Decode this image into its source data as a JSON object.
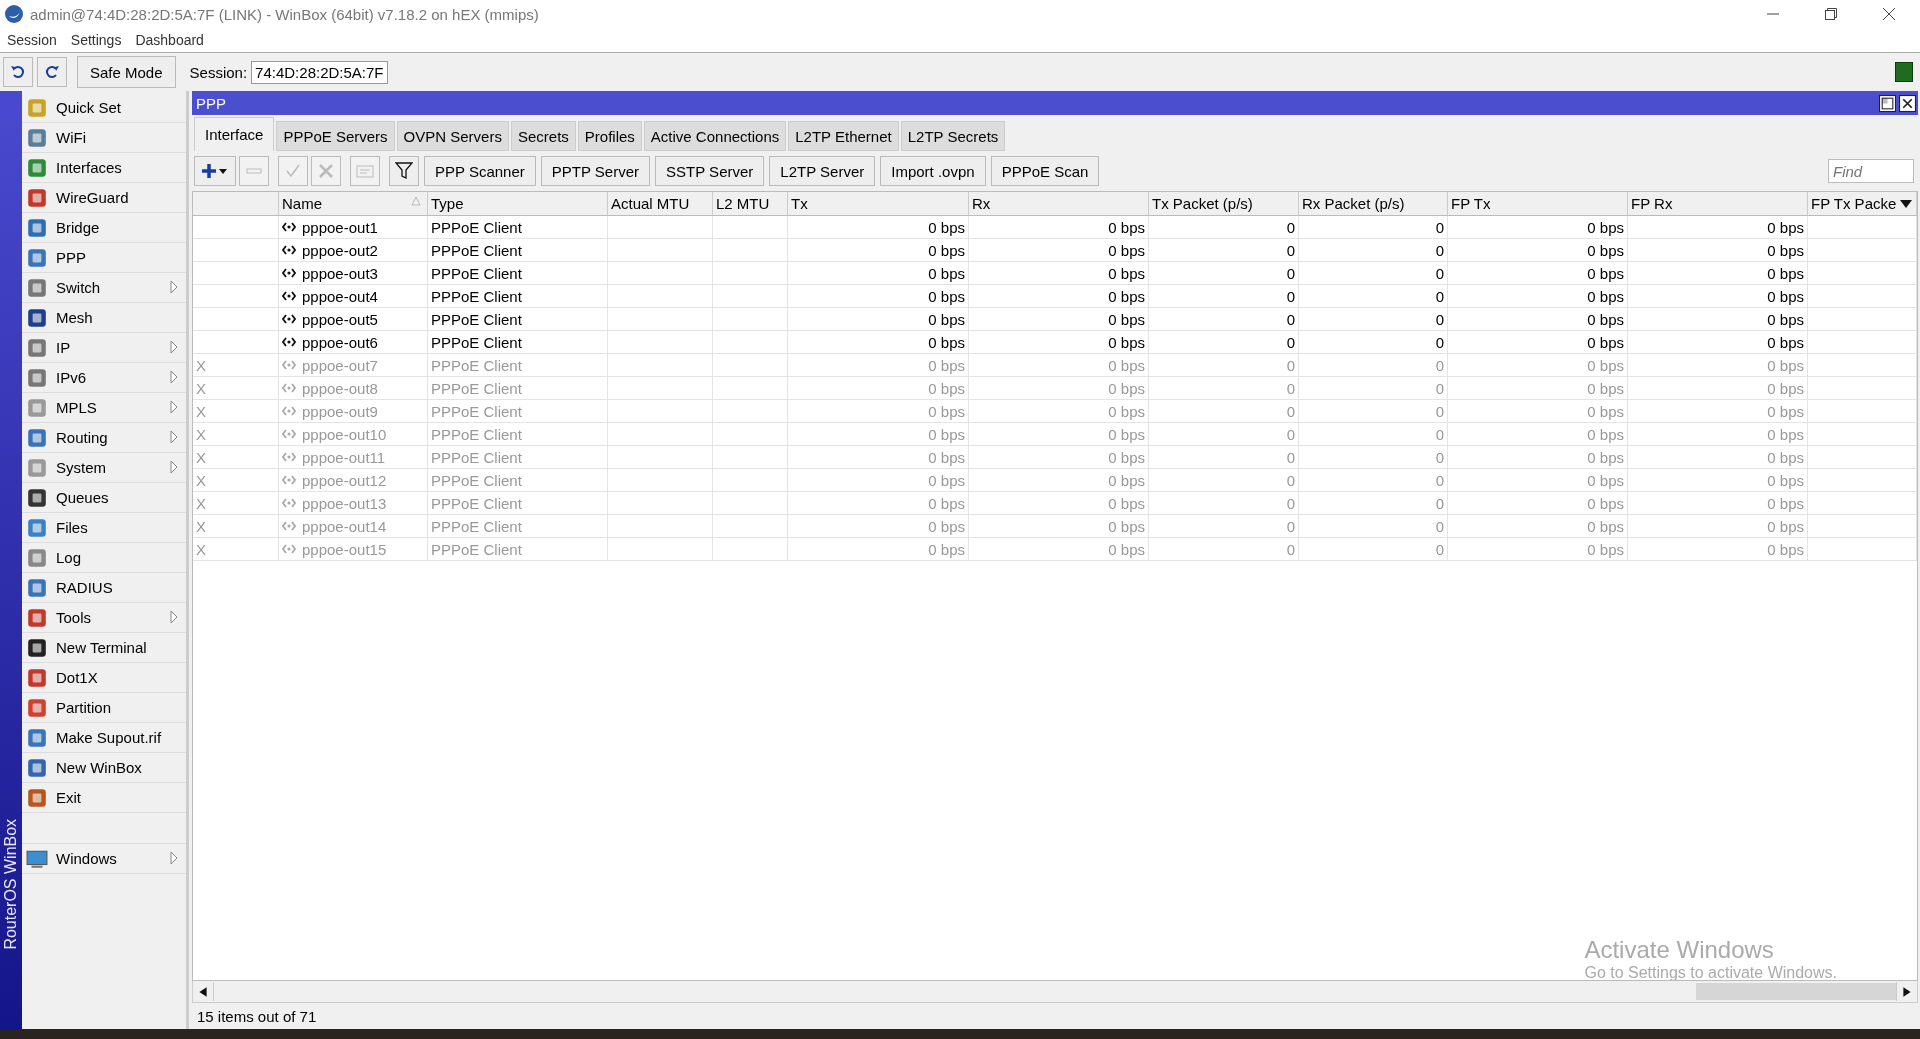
{
  "window": {
    "title": "admin@74:4D:28:2D:5A:7F (LINK) - WinBox (64bit) v7.18.2 on hEX (mmips)"
  },
  "menu_bar": [
    "Session",
    "Settings",
    "Dashboard"
  ],
  "toolbar": {
    "safe_mode": "Safe Mode",
    "session_label": "Session:",
    "session_value": "74:4D:28:2D:5A:7F"
  },
  "sidebar": {
    "brand": "RouterOS WinBox",
    "items": [
      {
        "label": "Quick Set",
        "submenu": false
      },
      {
        "label": "WiFi",
        "submenu": false
      },
      {
        "label": "Interfaces",
        "submenu": false
      },
      {
        "label": "WireGuard",
        "submenu": false
      },
      {
        "label": "Bridge",
        "submenu": false
      },
      {
        "label": "PPP",
        "submenu": false
      },
      {
        "label": "Switch",
        "submenu": true
      },
      {
        "label": "Mesh",
        "submenu": false
      },
      {
        "label": "IP",
        "submenu": true
      },
      {
        "label": "IPv6",
        "submenu": true
      },
      {
        "label": "MPLS",
        "submenu": true
      },
      {
        "label": "Routing",
        "submenu": true
      },
      {
        "label": "System",
        "submenu": true
      },
      {
        "label": "Queues",
        "submenu": false
      },
      {
        "label": "Files",
        "submenu": false
      },
      {
        "label": "Log",
        "submenu": false
      },
      {
        "label": "RADIUS",
        "submenu": false
      },
      {
        "label": "Tools",
        "submenu": true
      },
      {
        "label": "New Terminal",
        "submenu": false
      },
      {
        "label": "Dot1X",
        "submenu": false
      },
      {
        "label": "Partition",
        "submenu": false
      },
      {
        "label": "Make Supout.rif",
        "submenu": false
      },
      {
        "label": "New WinBox",
        "submenu": false
      },
      {
        "label": "Exit",
        "submenu": false
      }
    ],
    "bottom_items": [
      {
        "label": "Windows",
        "submenu": true
      }
    ]
  },
  "ppp_window": {
    "title": "PPP",
    "tabs": [
      {
        "label": "Interface",
        "selected": true
      },
      {
        "label": "PPPoE Servers",
        "selected": false
      },
      {
        "label": "OVPN Servers",
        "selected": false
      },
      {
        "label": "Secrets",
        "selected": false
      },
      {
        "label": "Profiles",
        "selected": false
      },
      {
        "label": "Active Connections",
        "selected": false
      },
      {
        "label": "L2TP Ethernet",
        "selected": false
      },
      {
        "label": "L2TP Secrets",
        "selected": false
      }
    ],
    "icon_buttons": [
      {
        "kind": "add",
        "disabled": false
      },
      {
        "kind": "remove",
        "disabled": true
      },
      {
        "kind": "enable",
        "disabled": true
      },
      {
        "kind": "disable",
        "disabled": true
      },
      {
        "kind": "comment",
        "disabled": true
      },
      {
        "kind": "filter",
        "disabled": false
      }
    ],
    "buttons": [
      "PPP Scanner",
      "PPTP Server",
      "SSTP Server",
      "L2TP Server",
      "Import .ovpn",
      "PPPoE Scan"
    ],
    "find": {
      "placeholder": "Find"
    },
    "table": {
      "columns": [
        "Name",
        "Type",
        "Actual MTU",
        "L2 MTU",
        "Tx",
        "Rx",
        "Tx Packet (p/s)",
        "Rx Packet (p/s)",
        "FP Tx",
        "FP Rx",
        "FP Tx Packe"
      ],
      "rows": [
        {
          "disabled": false,
          "name": "pppoe-out1",
          "type": "PPPoE Client",
          "tx": "0 bps",
          "rx": "0 bps",
          "tx_packet": "0",
          "rx_packet": "0",
          "fp_tx": "0 bps",
          "fp_rx": "0 bps"
        },
        {
          "disabled": false,
          "name": "pppoe-out2",
          "type": "PPPoE Client",
          "tx": "0 bps",
          "rx": "0 bps",
          "tx_packet": "0",
          "rx_packet": "0",
          "fp_tx": "0 bps",
          "fp_rx": "0 bps"
        },
        {
          "disabled": false,
          "name": "pppoe-out3",
          "type": "PPPoE Client",
          "tx": "0 bps",
          "rx": "0 bps",
          "tx_packet": "0",
          "rx_packet": "0",
          "fp_tx": "0 bps",
          "fp_rx": "0 bps"
        },
        {
          "disabled": false,
          "name": "pppoe-out4",
          "type": "PPPoE Client",
          "tx": "0 bps",
          "rx": "0 bps",
          "tx_packet": "0",
          "rx_packet": "0",
          "fp_tx": "0 bps",
          "fp_rx": "0 bps"
        },
        {
          "disabled": false,
          "name": "pppoe-out5",
          "type": "PPPoE Client",
          "tx": "0 bps",
          "rx": "0 bps",
          "tx_packet": "0",
          "rx_packet": "0",
          "fp_tx": "0 bps",
          "fp_rx": "0 bps"
        },
        {
          "disabled": false,
          "name": "pppoe-out6",
          "type": "PPPoE Client",
          "tx": "0 bps",
          "rx": "0 bps",
          "tx_packet": "0",
          "rx_packet": "0",
          "fp_tx": "0 bps",
          "fp_rx": "0 bps"
        },
        {
          "flag": "X",
          "disabled": true,
          "name": "pppoe-out7",
          "type": "PPPoE Client",
          "tx": "0 bps",
          "rx": "0 bps",
          "tx_packet": "0",
          "rx_packet": "0",
          "fp_tx": "0 bps",
          "fp_rx": "0 bps"
        },
        {
          "flag": "X",
          "disabled": true,
          "name": "pppoe-out8",
          "type": "PPPoE Client",
          "tx": "0 bps",
          "rx": "0 bps",
          "tx_packet": "0",
          "rx_packet": "0",
          "fp_tx": "0 bps",
          "fp_rx": "0 bps"
        },
        {
          "flag": "X",
          "disabled": true,
          "name": "pppoe-out9",
          "type": "PPPoE Client",
          "tx": "0 bps",
          "rx": "0 bps",
          "tx_packet": "0",
          "rx_packet": "0",
          "fp_tx": "0 bps",
          "fp_rx": "0 bps"
        },
        {
          "flag": "X",
          "disabled": true,
          "name": "pppoe-out10",
          "type": "PPPoE Client",
          "tx": "0 bps",
          "rx": "0 bps",
          "tx_packet": "0",
          "rx_packet": "0",
          "fp_tx": "0 bps",
          "fp_rx": "0 bps"
        },
        {
          "flag": "X",
          "disabled": true,
          "name": "pppoe-out11",
          "type": "PPPoE Client",
          "tx": "0 bps",
          "rx": "0 bps",
          "tx_packet": "0",
          "rx_packet": "0",
          "fp_tx": "0 bps",
          "fp_rx": "0 bps"
        },
        {
          "flag": "X",
          "disabled": true,
          "name": "pppoe-out12",
          "type": "PPPoE Client",
          "tx": "0 bps",
          "rx": "0 bps",
          "tx_packet": "0",
          "rx_packet": "0",
          "fp_tx": "0 bps",
          "fp_rx": "0 bps"
        },
        {
          "flag": "X",
          "disabled": true,
          "name": "pppoe-out13",
          "type": "PPPoE Client",
          "tx": "0 bps",
          "rx": "0 bps",
          "tx_packet": "0",
          "rx_packet": "0",
          "fp_tx": "0 bps",
          "fp_rx": "0 bps"
        },
        {
          "flag": "X",
          "disabled": true,
          "name": "pppoe-out14",
          "type": "PPPoE Client",
          "tx": "0 bps",
          "rx": "0 bps",
          "tx_packet": "0",
          "rx_packet": "0",
          "fp_tx": "0 bps",
          "fp_rx": "0 bps"
        },
        {
          "flag": "X",
          "disabled": true,
          "name": "pppoe-out15",
          "type": "PPPoE Client",
          "tx": "0 bps",
          "rx": "0 bps",
          "tx_packet": "0",
          "rx_packet": "0",
          "fp_tx": "0 bps",
          "fp_rx": "0 bps"
        }
      ]
    },
    "status": "15 items out of 71"
  },
  "activation_notice": {
    "title": "Activate Windows",
    "text": "Go to Settings to activate Windows."
  }
}
